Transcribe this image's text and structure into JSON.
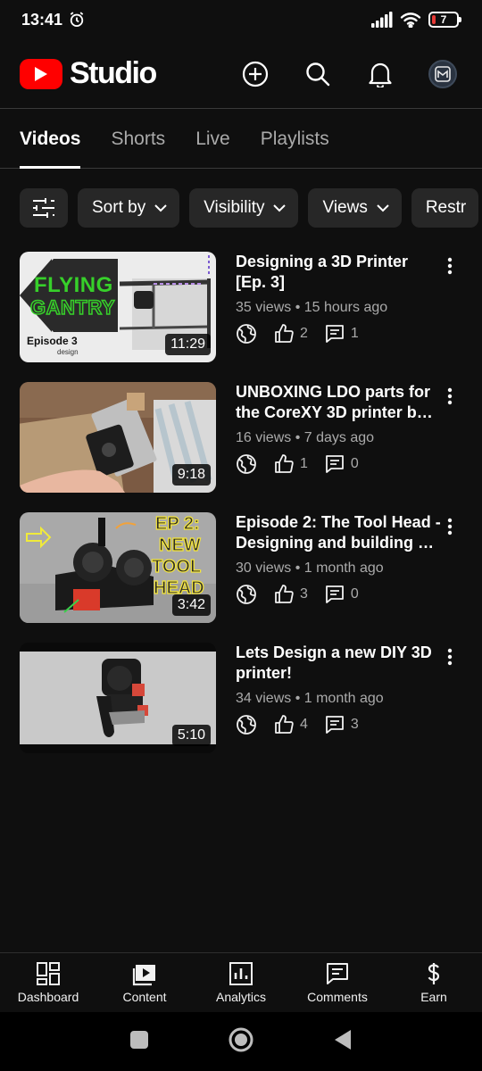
{
  "status_bar": {
    "time": "13:41",
    "battery": "7"
  },
  "app": {
    "brand_text": "Studio"
  },
  "tabs": [
    {
      "label": "Videos",
      "active": true
    },
    {
      "label": "Shorts"
    },
    {
      "label": "Live"
    },
    {
      "label": "Playlists"
    }
  ],
  "filters": {
    "sort_label": "Sort by",
    "visibility_label": "Visibility",
    "views_label": "Views",
    "restrictions_label": "Restr"
  },
  "videos": [
    {
      "title": "Designing a 3D Printer [Ep. 3]",
      "meta": "35 views • 15 hours ago",
      "likes": "2",
      "comments": "1",
      "duration": "11:29",
      "thumb_text_1": "FLYING",
      "thumb_text_2": "GANTRY",
      "thumb_text_3": "Episode 3",
      "thumb_text_4": "design"
    },
    {
      "title": "UNBOXING LDO parts for the CoreXY 3D printer b…",
      "meta": "16 views • 7 days ago",
      "likes": "1",
      "comments": "0",
      "duration": "9:18"
    },
    {
      "title": "Episode 2: The Tool Head - Designing and building …",
      "meta": "30 views • 1 month ago",
      "likes": "3",
      "comments": "0",
      "duration": "3:42",
      "thumb_text_1": "EP 2:",
      "thumb_text_2": "NEW",
      "thumb_text_3": "TOOL",
      "thumb_text_4": "HEAD"
    },
    {
      "title": "Lets Design a new DIY 3D printer!",
      "meta": "34 views • 1 month ago",
      "likes": "4",
      "comments": "3",
      "duration": "5:10"
    }
  ],
  "bottom_nav": [
    {
      "label": "Dashboard",
      "icon": "dashboard-icon"
    },
    {
      "label": "Content",
      "icon": "content-icon"
    },
    {
      "label": "Analytics",
      "icon": "analytics-icon"
    },
    {
      "label": "Comments",
      "icon": "comments-icon"
    },
    {
      "label": "Earn",
      "icon": "earn-icon"
    }
  ],
  "colors": {
    "brand_red": "#ff0000",
    "background": "#0f0f0f",
    "chip_bg": "#272727",
    "muted_text": "#aaaaaa"
  }
}
